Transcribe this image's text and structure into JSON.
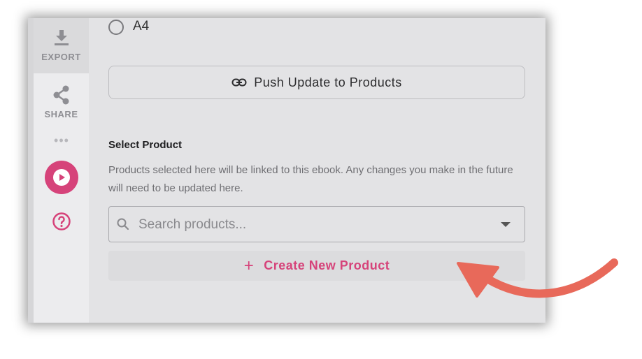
{
  "sidebar": {
    "export_label": "EXPORT",
    "share_label": "SHARE",
    "more_label": "•••",
    "accent_color": "#d6437a"
  },
  "format_option": {
    "label": "A4"
  },
  "push_button": {
    "label": "Push Update to Products"
  },
  "select_product": {
    "title": "Select Product",
    "help_text": "Products selected here will be linked to this ebook. Any changes you make in the future will need to be updated here.",
    "search_placeholder": "Search products...",
    "create_label": "Create New Product",
    "create_plus": "+"
  },
  "annotation": {
    "arrow_color": "#e8695a"
  }
}
